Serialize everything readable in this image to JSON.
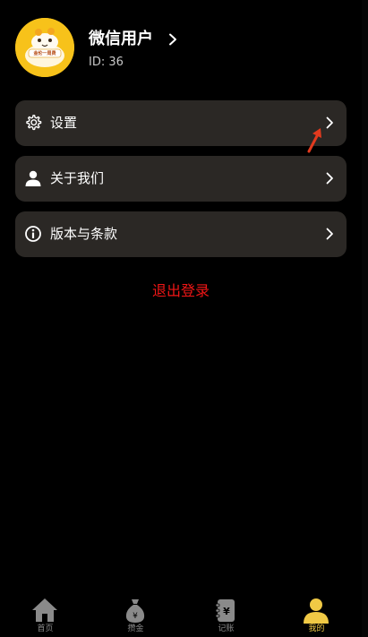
{
  "profile": {
    "nickname": "微信用户",
    "id_text": "ID: 36",
    "avatar_caption": "金伦一周费"
  },
  "menu": [
    {
      "label": "设置",
      "icon": "gear-icon"
    },
    {
      "label": "关于我们",
      "icon": "person-icon"
    },
    {
      "label": "版本与条款",
      "icon": "info-icon"
    }
  ],
  "logout_label": "退出登录",
  "tabs": [
    {
      "label": "首页",
      "icon": "home-icon",
      "active": false
    },
    {
      "label": "攒金",
      "icon": "money-bag-icon",
      "active": false
    },
    {
      "label": "记账",
      "icon": "ledger-icon",
      "active": false
    },
    {
      "label": "我的",
      "icon": "profile-icon",
      "active": true
    }
  ],
  "colors": {
    "background": "#000000",
    "card": "#2b2825",
    "accent": "#f0c945",
    "logout": "#f01616",
    "inactive_tab": "#8a8a8a"
  }
}
